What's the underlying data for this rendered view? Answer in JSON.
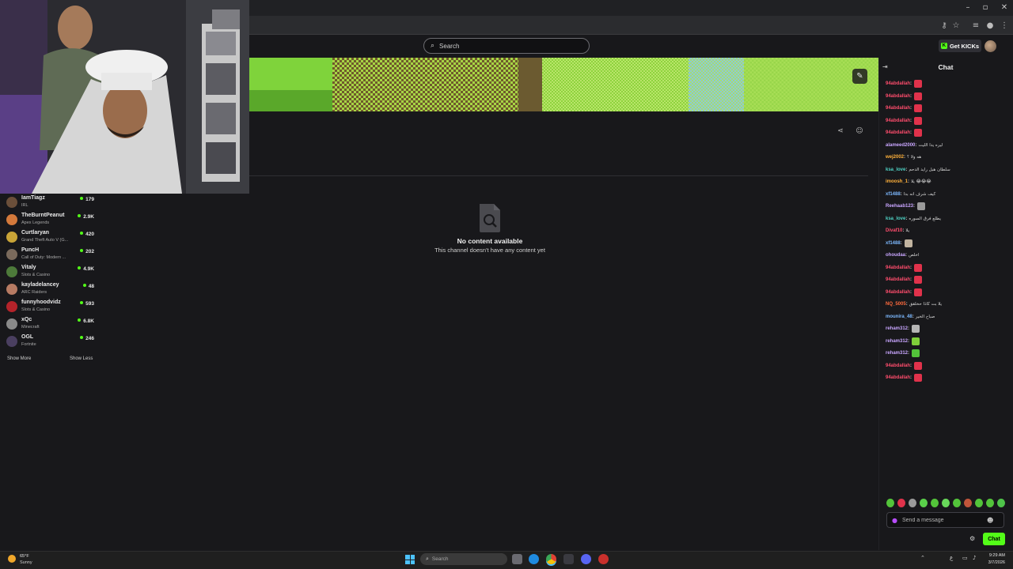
{
  "browser": {
    "window_controls": {
      "minimize": "–",
      "maximize": "▫",
      "close": "✕"
    }
  },
  "site": {
    "search_placeholder": "Search",
    "get_kicks_label": "Get KICKs",
    "kicks_logo": "K"
  },
  "channel": {
    "empty_title": "No content available",
    "empty_subtitle": "This channel doesn't have any content yet"
  },
  "sidebar": {
    "channels": [
      {
        "name": "IamTiagz",
        "game": "IRL",
        "viewers": "179",
        "color": "#6b4f3a"
      },
      {
        "name": "TheBurntPeanut",
        "game": "Apex Legends",
        "viewers": "2.9K",
        "color": "#d4793b"
      },
      {
        "name": "Curtlaryan",
        "game": "Grand Theft Auto V (G...",
        "viewers": "420",
        "color": "#c9a437"
      },
      {
        "name": "PuncH",
        "game": "Call of Duty: Modern ...",
        "viewers": "202",
        "color": "#7a6a5c"
      },
      {
        "name": "Vitaly",
        "game": "Slots & Casino",
        "viewers": "4.9K",
        "color": "#4d7a3a"
      },
      {
        "name": "kayladelancey",
        "game": "ARC Raiders",
        "viewers": "48",
        "color": "#b77b63"
      },
      {
        "name": "funnyhoodvidz",
        "game": "Slots & Casino",
        "viewers": "593",
        "color": "#b4232a"
      },
      {
        "name": "xQc",
        "game": "Minecraft",
        "viewers": "6.8K",
        "color": "#8a8a8a"
      },
      {
        "name": "OGL",
        "game": "Fortnite",
        "viewers": "246",
        "color": "#4a3f60"
      }
    ],
    "show_more": "Show More",
    "show_less": "Show Less"
  },
  "chat": {
    "title": "Chat",
    "messages": [
      {
        "user": "94abdallah",
        "color": "#ff4d6d",
        "text": "",
        "emote": "#e0324b"
      },
      {
        "user": "94abdallah",
        "color": "#ff4d6d",
        "text": "",
        "emote": "#e0324b"
      },
      {
        "user": "94abdallah",
        "color": "#ff4d6d",
        "text": "",
        "emote": "#e0324b"
      },
      {
        "user": "94abdallah",
        "color": "#ff4d6d",
        "text": "",
        "emote": "#e0324b"
      },
      {
        "user": "94abdallah",
        "color": "#ff4d6d",
        "text": "",
        "emote": "#e0324b"
      },
      {
        "user": "alameed2000",
        "color": "#c9a6ff",
        "text": "ليره يدا الليت",
        "emote": ""
      },
      {
        "user": "wej2002",
        "color": "#ffb13b",
        "text": "هه ولا ؟",
        "emote": ""
      },
      {
        "user": "ksa_love",
        "color": "#4fd4c6",
        "text": "سلطان هبل رايد الدحم",
        "emote": ""
      },
      {
        "user": "imoosh_1",
        "color": "#ffb13b",
        "text": "يلا 😂😂😂",
        "emote": ""
      },
      {
        "user": "xf1488",
        "color": "#7db9ff",
        "text": "كيف شرف انه بدا",
        "emote": ""
      },
      {
        "user": "Reehaab123",
        "color": "#c9a6ff",
        "text": "",
        "emote": "#9a9a9a"
      },
      {
        "user": "ksa_love",
        "color": "#4fd4c6",
        "text": "يطلع فرق السوره",
        "emote": ""
      },
      {
        "user": "Divaf10",
        "color": "#ff4d6d",
        "text": "يلا",
        "emote": ""
      },
      {
        "user": "xf1488",
        "color": "#7db9ff",
        "text": "",
        "emote": "#c2b4a0"
      },
      {
        "user": "ohoudaa",
        "color": "#c9a6ff",
        "text": "اخلص",
        "emote": ""
      },
      {
        "user": "94abdallah",
        "color": "#ff4d6d",
        "text": "",
        "emote": "#e0324b"
      },
      {
        "user": "94abdallah",
        "color": "#ff4d6d",
        "text": "",
        "emote": "#e0324b"
      },
      {
        "user": "94abdallah",
        "color": "#ff4d6d",
        "text": "",
        "emote": "#e0324b"
      },
      {
        "user": "NQ_5005",
        "color": "#ff6a3d",
        "text": "يلا بت كاذا حخلقق",
        "emote": ""
      },
      {
        "user": "mounira_48",
        "color": "#7db9ff",
        "text": "صباح الخير",
        "emote": ""
      },
      {
        "user": "reham312",
        "color": "#c9a6ff",
        "text": "",
        "emote": "#b5b5b5"
      },
      {
        "user": "reham312",
        "color": "#c9a6ff",
        "text": "",
        "emote": "#7fcf3a"
      },
      {
        "user": "reham312",
        "color": "#c9a6ff",
        "text": "",
        "emote": "#53c43a"
      },
      {
        "user": "94abdallah",
        "color": "#ff4d6d",
        "text": "",
        "emote": "#e0324b"
      },
      {
        "user": "94abdallah",
        "color": "#ff4d6d",
        "text": "",
        "emote": "#e0324b"
      }
    ],
    "emotes": [
      "#53c43a",
      "#e0324b",
      "#9a9a9a",
      "#5ad04a",
      "#53c43a",
      "#68d85a",
      "#53c43a",
      "#c0553a",
      "#53c43a",
      "#53c43a",
      "#4fc44a"
    ],
    "input_placeholder": "Send a message",
    "send_label": "Chat"
  },
  "taskbar": {
    "weather_temp": "65°F",
    "weather_cond": "Sunny",
    "search_placeholder": "Search",
    "time": "9:29 AM",
    "date": "3/7/2026"
  },
  "accent": "#53fc18"
}
